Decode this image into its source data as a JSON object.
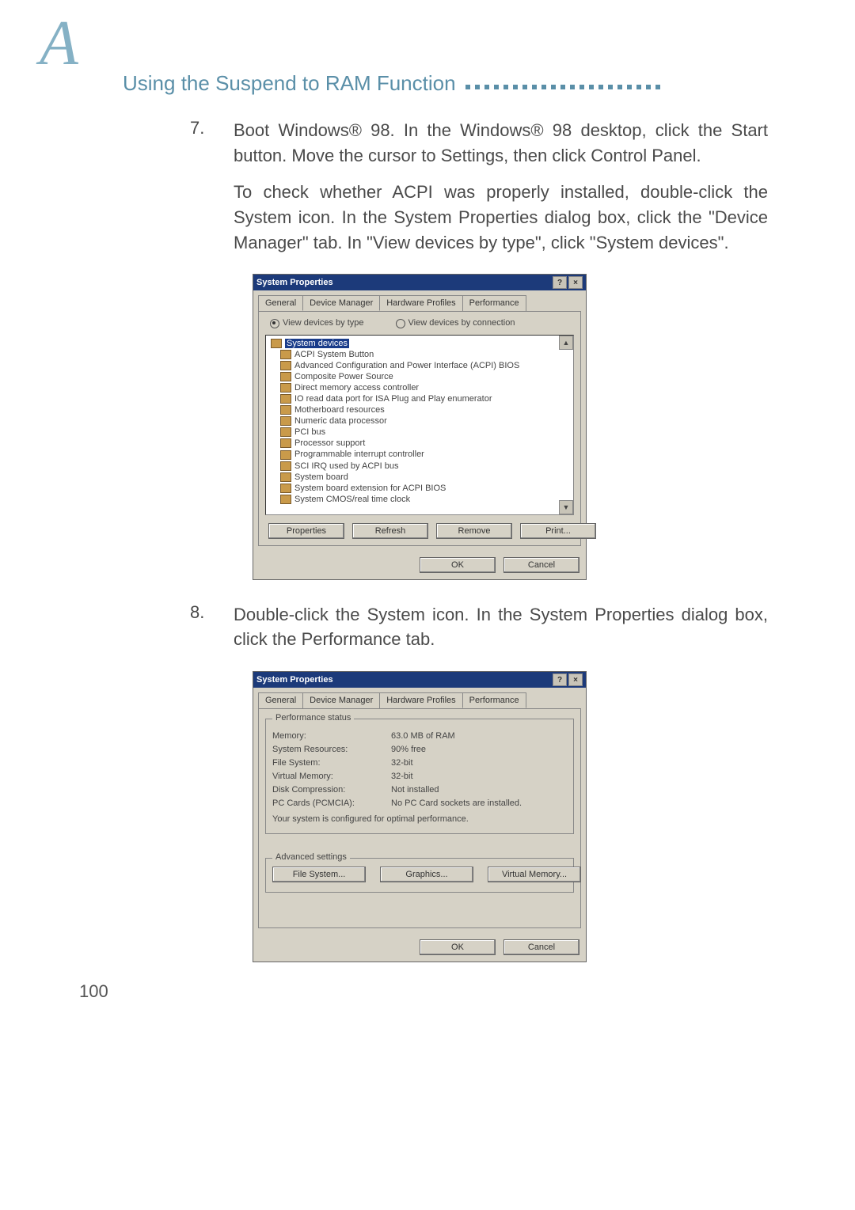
{
  "header": {
    "letter": "A",
    "title": "Using the Suspend to RAM Function"
  },
  "step7": {
    "num": "7.",
    "text": "Boot Windows® 98. In the Windows® 98 desktop, click the Start button. Move the cursor to Settings, then click Control Panel.",
    "para2": "To check whether ACPI was properly installed, double-click the System icon. In the System Properties dialog box, click the \"Device Manager\" tab. In \"View devices by type\", click \"System devices\"."
  },
  "dialog1": {
    "title": "System Properties",
    "tabs": {
      "t1": "General",
      "t2": "Device Manager",
      "t3": "Hardware Profiles",
      "t4": "Performance"
    },
    "radio1": "View devices by type",
    "radio2": "View devices by connection",
    "tree": {
      "root": "System devices",
      "items": [
        "ACPI System Button",
        "Advanced Configuration and Power Interface (ACPI) BIOS",
        "Composite Power Source",
        "Direct memory access controller",
        "IO read data port for ISA Plug and Play enumerator",
        "Motherboard resources",
        "Numeric data processor",
        "PCI bus",
        "Processor support",
        "Programmable interrupt controller",
        "SCI IRQ used by ACPI bus",
        "System board",
        "System board extension for ACPI BIOS",
        "System CMOS/real time clock"
      ]
    },
    "buttons": {
      "props": "Properties",
      "refresh": "Refresh",
      "remove": "Remove",
      "print": "Print..."
    },
    "ok": "OK",
    "cancel": "Cancel",
    "help": "?",
    "close": "×"
  },
  "step8": {
    "num": "8.",
    "text": "Double-click the System icon. In the System Properties dialog box, click the Performance tab."
  },
  "dialog2": {
    "title": "System Properties",
    "tabs": {
      "t1": "General",
      "t2": "Device Manager",
      "t3": "Hardware Profiles",
      "t4": "Performance"
    },
    "group1": "Performance status",
    "rows": {
      "mem_k": "Memory:",
      "mem_v": "63.0 MB of RAM",
      "sys_k": "System Resources:",
      "sys_v": "90% free",
      "fs_k": "File System:",
      "fs_v": "32-bit",
      "vm_k": "Virtual Memory:",
      "vm_v": "32-bit",
      "dc_k": "Disk Compression:",
      "dc_v": "Not installed",
      "pc_k": "PC Cards (PCMCIA):",
      "pc_v": "No PC Card sockets are installed."
    },
    "optimal": "Your system is configured for optimal performance.",
    "group2": "Advanced settings",
    "adv": {
      "fs": "File System...",
      "gfx": "Graphics...",
      "vmem": "Virtual Memory..."
    },
    "ok": "OK",
    "cancel": "Cancel",
    "help": "?",
    "close": "×"
  },
  "pagenum": "100"
}
